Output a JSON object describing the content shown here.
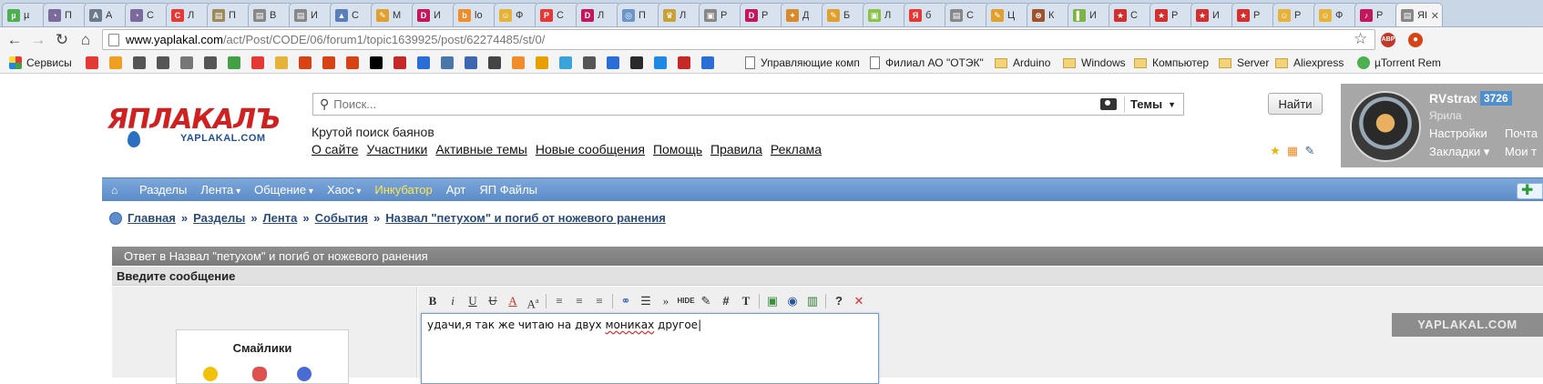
{
  "browser": {
    "tabs": [
      {
        "label": "µ",
        "color": "#4caf50",
        "glyph": "µ"
      },
      {
        "label": "П",
        "color": "#7a6b9c",
        "glyph": "◔"
      },
      {
        "label": "А",
        "color": "#6b7a8c",
        "glyph": "A"
      },
      {
        "label": "С",
        "color": "#7a6b9c",
        "glyph": "◔"
      },
      {
        "label": "Л",
        "color": "#e53935",
        "glyph": "C"
      },
      {
        "label": "П",
        "color": "#9e8b5c",
        "glyph": "▤"
      },
      {
        "label": "В",
        "color": "#888888",
        "glyph": "▤"
      },
      {
        "label": "И",
        "color": "#888888",
        "glyph": "▤"
      },
      {
        "label": "С",
        "color": "#5a7fb8",
        "glyph": "▲"
      },
      {
        "label": "М",
        "color": "#e0a030",
        "glyph": "✎"
      },
      {
        "label": "И",
        "color": "#c2185b",
        "glyph": "D"
      },
      {
        "label": "lo",
        "color": "#f08c2a",
        "glyph": "b"
      },
      {
        "label": "Ф",
        "color": "#e5b23a",
        "glyph": "☺"
      },
      {
        "label": "С",
        "color": "#e53935",
        "glyph": "P"
      },
      {
        "label": "Л",
        "color": "#c2185b",
        "glyph": "D"
      },
      {
        "label": "П",
        "color": "#6a95c9",
        "glyph": "◎"
      },
      {
        "label": "Л",
        "color": "#c7a23a",
        "glyph": "♛"
      },
      {
        "label": "Р",
        "color": "#888888",
        "glyph": "▣"
      },
      {
        "label": "Р",
        "color": "#c2185b",
        "glyph": "D"
      },
      {
        "label": "Д",
        "color": "#d98b2b",
        "glyph": "✦"
      },
      {
        "label": "Б",
        "color": "#e0a030",
        "glyph": "✎"
      },
      {
        "label": "Л",
        "color": "#8bc34a",
        "glyph": "▣"
      },
      {
        "label": "б",
        "color": "#e53935",
        "glyph": "Я"
      },
      {
        "label": "С",
        "color": "#888888",
        "glyph": "▤"
      },
      {
        "label": "Ц",
        "color": "#e0a030",
        "glyph": "✎"
      },
      {
        "label": "К",
        "color": "#a0522d",
        "glyph": "⊛"
      },
      {
        "label": "И",
        "color": "#7cb342",
        "glyph": "▌"
      },
      {
        "label": "С",
        "color": "#d32f2f",
        "glyph": "★"
      },
      {
        "label": "Р",
        "color": "#d32f2f",
        "glyph": "★"
      },
      {
        "label": "И",
        "color": "#d32f2f",
        "glyph": "★"
      },
      {
        "label": "Р",
        "color": "#d32f2f",
        "glyph": "★"
      },
      {
        "label": "Р",
        "color": "#e5b23a",
        "glyph": "☺"
      },
      {
        "label": "Ф",
        "color": "#e5b23a",
        "glyph": "☺"
      },
      {
        "label": "Р",
        "color": "#c2185b",
        "glyph": "♪"
      },
      {
        "label": "ЯI",
        "color": "#888888",
        "glyph": "▤"
      }
    ],
    "url_host": "www.yaplakal.com",
    "url_path": "/act/Post/CODE/06/forum1/topic1639925/post/62274485/st/0/",
    "bookmarks": {
      "services": "Сервисы",
      "b1": "Управляющие комп",
      "b2": "Филиал АО \"ОТЭК\"",
      "b3": "Arduino",
      "b4": "Windows",
      "b5": "Компьютер",
      "b6": "Server",
      "b7": "Aliexpress",
      "b8": "µTorrent Rem"
    },
    "ext_badge": "ABP"
  },
  "site": {
    "logo_text": "ЯПЛАКАЛЪ",
    "logo_sub": "YAPLAKAL.COM",
    "search_placeholder": "Поиск...",
    "search_scope": "Темы",
    "find_button": "Найти",
    "tagline": "Крутой поиск баянов",
    "top_links": [
      "О сайте",
      "Участники",
      "Активные темы",
      "Новые сообщения",
      "Помощь",
      "Правила",
      "Реклама"
    ],
    "user": {
      "name": "RVstrax",
      "karma": "3726",
      "rank": "Ярила",
      "settings": "Настройки",
      "mail": "Почта",
      "bookmarks": "Закладки",
      "mine": "Мои т"
    },
    "nav": {
      "sections": "Разделы",
      "feed": "Лента",
      "talk": "Общение",
      "chaos": "Хаос",
      "incubator": "Инкубатор",
      "art": "Арт",
      "files": "ЯП Файлы"
    },
    "breadcrumb": {
      "home": "Главная",
      "sections": "Разделы",
      "feed": "Лента",
      "events": "События",
      "topic": "Назвал \"петухом\" и погиб от ножевого ранения"
    },
    "reply_header": "Ответ в Назвал \"петухом\" и погиб от ножевого ранения",
    "enter_message": "Введите сообщение",
    "smiles_title": "Смайлики",
    "editor": {
      "text_before": "удачи,я так же читаю на двух ",
      "text_misspelled": "мониках",
      "text_after": " другое"
    },
    "watermark": "YAPLAKAL.COM"
  }
}
